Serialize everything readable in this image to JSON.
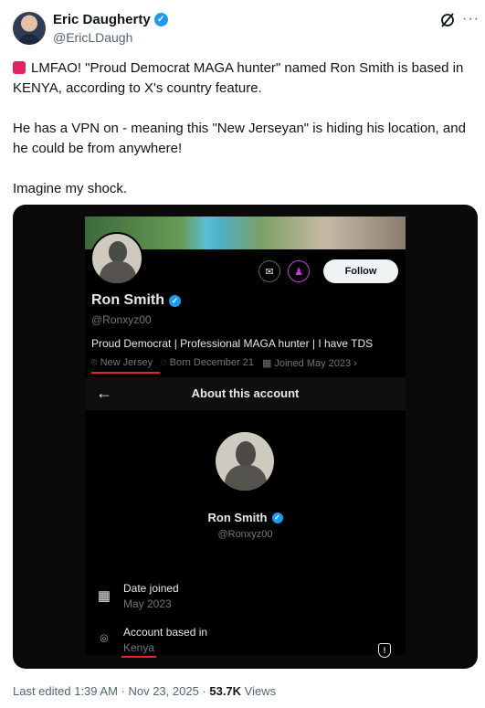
{
  "author": {
    "name": "Eric Daugherty",
    "handle": "@EricLDaugh"
  },
  "tweet": {
    "para1": "LMFAO! \"Proud Democrat MAGA hunter\" named Ron Smith is based in KENYA, according to X's country feature.",
    "para2": "He has a VPN on - meaning this \"New Jerseyan\" is hiding his location, and he could be from anywhere!",
    "para3": "Imagine my shock."
  },
  "profile": {
    "follow_label": "Follow",
    "name": "Ron Smith",
    "handle": "@Ronxyz00",
    "bio": "Proud Democrat | Professional MAGA hunter | I have TDS",
    "location": "New Jersey",
    "born": "Born December 21",
    "joined": "Joined May 2023"
  },
  "about": {
    "title": "About this account",
    "name": "Ron Smith",
    "handle": "@Ronxyz00",
    "date_joined_label": "Date joined",
    "date_joined_value": "May 2023",
    "based_in_label": "Account based in",
    "based_in_value": "Kenya"
  },
  "footer": {
    "edited": "Last edited 1:39 AM · Nov 23, 2025 · ",
    "views_count": "53.7K",
    "views_label": " Views"
  },
  "colors": {
    "verified": "#1d9bf0",
    "highlight_underline": "#e0232c"
  }
}
